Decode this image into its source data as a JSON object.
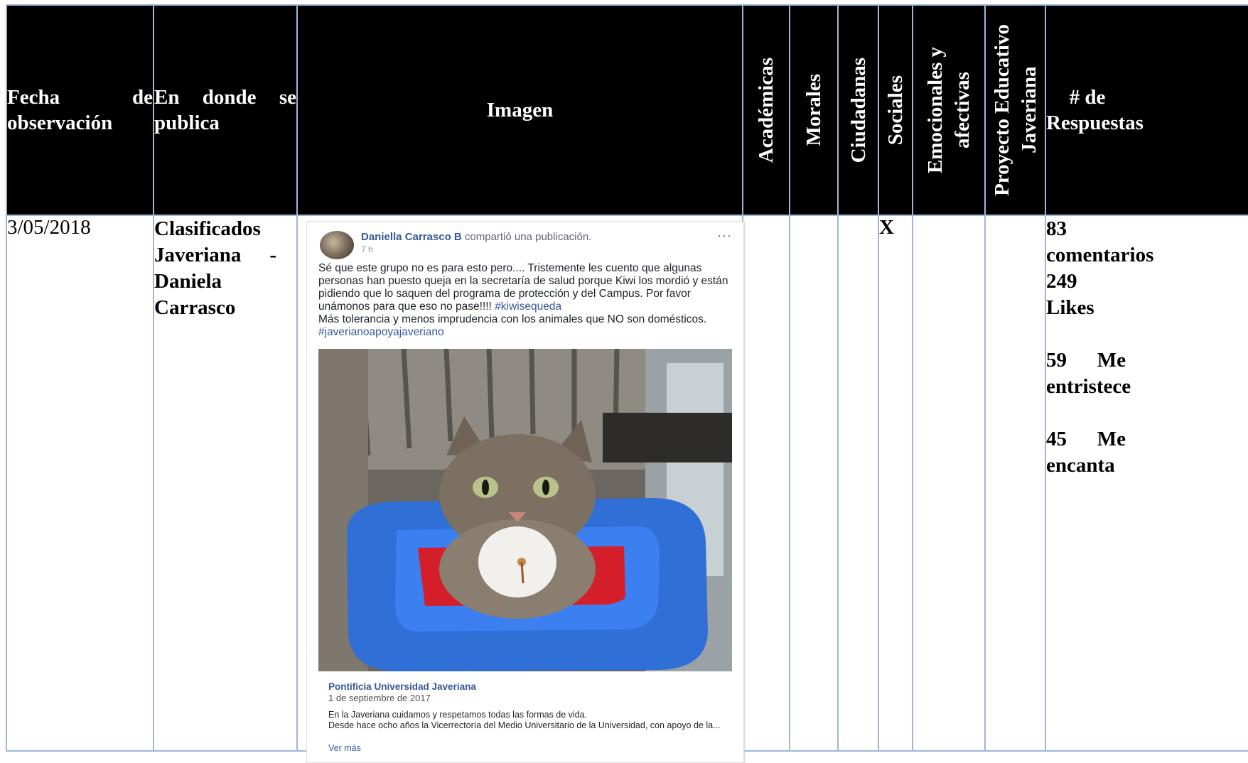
{
  "headers": {
    "fecha": "Fecha de observación",
    "donde": "En donde se publica",
    "imagen": "Imagen",
    "academicas": "Académicas",
    "morales": "Morales",
    "ciudadanas": "Ciudadanas",
    "sociales": "Sociales",
    "emocionales_1": "Emocionales y",
    "emocionales_2": "afectivas",
    "proyecto_1": "Proyecto Educativo",
    "proyecto_2": "Javeriana",
    "respuestas": "# de Respuestas"
  },
  "row": {
    "fecha": "3/05/2018",
    "donde": "Clasificados Javeriana - Daniela Carrasco",
    "sociales_mark": "X",
    "resp_comentarios": "83 comentarios",
    "resp_likes": "249 Likes",
    "resp_entristece": "59 Me entristece",
    "resp_encanta": "45 Me encanta"
  },
  "post": {
    "author": "Daniella Carrasco B",
    "shared": "compartió una publicación.",
    "time": "7 h",
    "more": "···",
    "text_main": "Sé que este grupo no es para esto pero.... Tristemente les cuento que algunas personas han puesto queja en la secretaría de salud porque Kiwi los mordió y están pidiendo que lo saquen del programa de protección y del Campus. Por favor unámonos para que eso no pase!!!!",
    "tag1": "#kiwisequeda",
    "text_second": "Más tolerancia y menos imprudencia con los animales que NO son domésticos.",
    "tag2": "#javerianoapoyajaveriano",
    "link_title": "Pontificia Universidad Javeriana",
    "link_date": "1 de septiembre de 2017",
    "link_desc_1": "En la Javeriana cuidamos y respetamos todas las formas de vida.",
    "link_desc_2": "Desde hace ocho años la Vicerrectoría del Medio Universitario de la Universidad, con apoyo de la...",
    "link_more": "Ver más"
  }
}
